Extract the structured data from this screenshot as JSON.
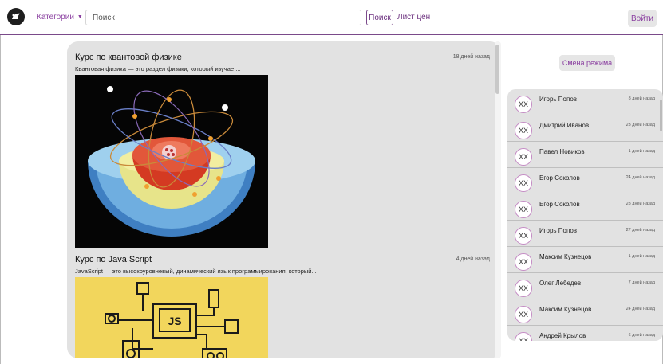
{
  "header": {
    "categories_label": "Категории",
    "search_placeholder": "Поиск",
    "search_button": "Поиск",
    "price_list": "Лист цен",
    "login": "Войти"
  },
  "courses": [
    {
      "title": "Курс по квантовой физике",
      "date": "18 дней назад",
      "description": "Квантовая физика — это раздел физики, который изучает..."
    },
    {
      "title": "Курс по Java Script",
      "date": "4 дней назад",
      "description": "JavaScript — это высокоуровневый, динамический язык программирования, который..."
    }
  ],
  "js_logo_text": "JS",
  "mode_button": "Смена режима",
  "users": [
    {
      "avatar": "XX",
      "name": "Игорь Попов",
      "date": "8 дней назад"
    },
    {
      "avatar": "XX",
      "name": "Дмитрий Иванов",
      "date": "23 дней назад"
    },
    {
      "avatar": "XX",
      "name": "Павел Новиков",
      "date": "1 дней назад"
    },
    {
      "avatar": "XX",
      "name": "Егор Соколов",
      "date": "24 дней назад"
    },
    {
      "avatar": "XX",
      "name": "Егор Соколов",
      "date": "28 дней назад"
    },
    {
      "avatar": "XX",
      "name": "Игорь Попов",
      "date": "27 дней назад"
    },
    {
      "avatar": "XX",
      "name": "Максим Кузнецов",
      "date": "1 дней назад"
    },
    {
      "avatar": "XX",
      "name": "Олег Лебедев",
      "date": "7 дней назад"
    },
    {
      "avatar": "XX",
      "name": "Максим Кузнецов",
      "date": "24 дней назад"
    },
    {
      "avatar": "XX",
      "name": "Андрей Крылов",
      "date": "6 дней назад"
    }
  ],
  "colors": {
    "accent": "#8a3fa0",
    "panel_bg": "#e2e2e2",
    "js_yellow": "#f2d65c"
  }
}
